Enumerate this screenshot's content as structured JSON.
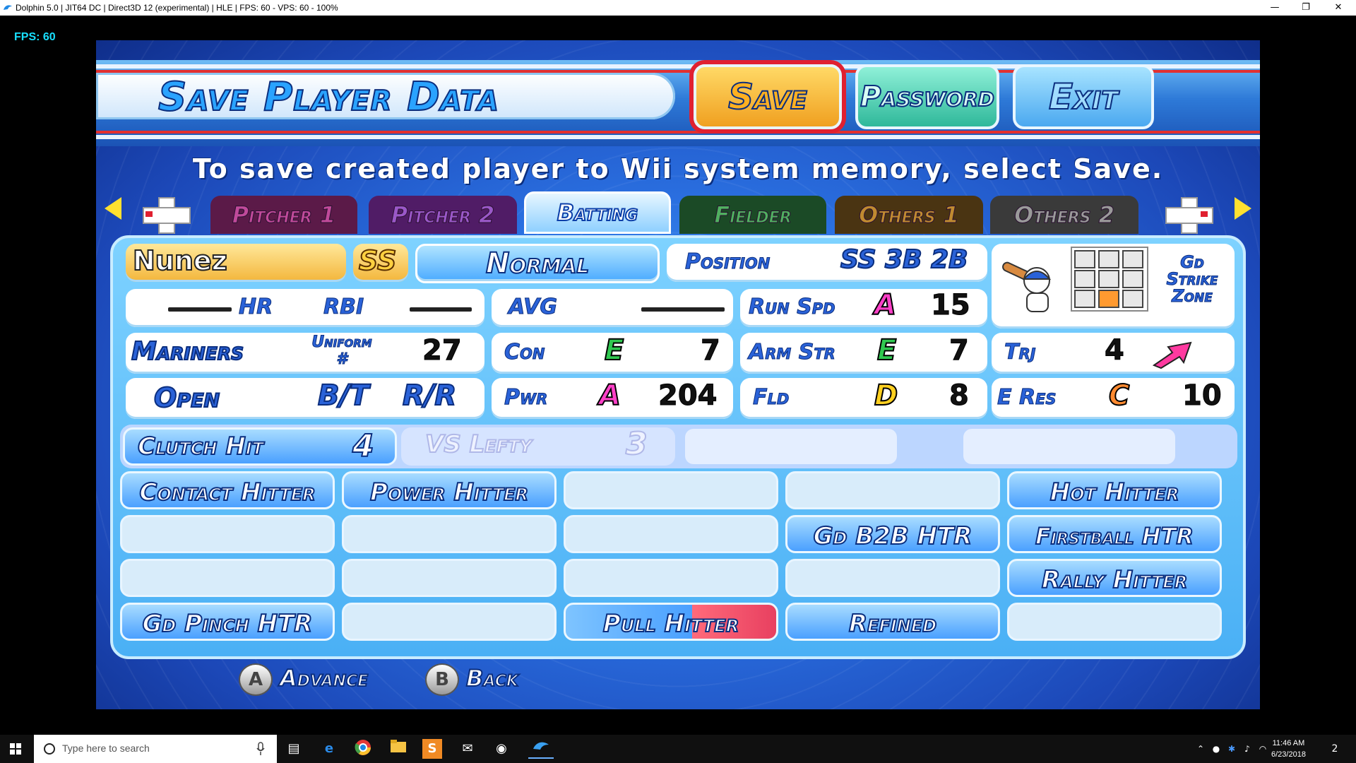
{
  "window": {
    "title": "Dolphin 5.0 | JIT64 DC | Direct3D 12 (experimental) | HLE | FPS: 60 - VPS: 60 - 100%",
    "minimize": "—",
    "maximize": "❐",
    "close": "✕"
  },
  "overlay": {
    "fps": "FPS: 60"
  },
  "header": {
    "title": "Save Player Data",
    "save": "Save",
    "password": "Password",
    "exit": "Exit"
  },
  "instruction": "To save created player to Wii system memory, select Save.",
  "tabs": [
    "Pitcher 1",
    "Pitcher 2",
    "Batting",
    "Fielder",
    "Others 1",
    "Others 2"
  ],
  "active_tab": "Batting",
  "player": {
    "name": "Nunez",
    "pos_badge": "SS",
    "mode": "Normal",
    "position_label": "Position",
    "positions": "SS 3B 2B",
    "hr_label": "HR",
    "rbi_label": "RBI",
    "avg_label": "AVG",
    "team": "Mariners",
    "uniform_label": "Uniform #",
    "uniform_no": "27",
    "bats_status": "Open",
    "bt_label": "B/T",
    "bt_value": "R/R",
    "strike_zone": "Gd Strike Zone"
  },
  "stats": {
    "run_spd": {
      "label": "Run Spd",
      "grade": "A",
      "value": "15"
    },
    "con": {
      "label": "Con",
      "grade": "E",
      "value": "7"
    },
    "arm_str": {
      "label": "Arm Str",
      "grade": "E",
      "value": "7"
    },
    "trj": {
      "label": "Trj",
      "value": "4"
    },
    "pwr": {
      "label": "Pwr",
      "grade": "A",
      "value": "204"
    },
    "fld": {
      "label": "Fld",
      "grade": "D",
      "value": "8"
    },
    "e_res": {
      "label": "E Res",
      "grade": "C",
      "value": "10"
    }
  },
  "special_row": {
    "clutch_label": "Clutch Hit",
    "clutch_val": "4",
    "lefty_label": "VS Lefty",
    "lefty_val": "3"
  },
  "abilities": [
    [
      "Contact Hitter",
      "Power Hitter",
      "",
      "",
      "Hot Hitter"
    ],
    [
      "",
      "",
      "",
      "Gd B2B HTR",
      "Firstball HTR"
    ],
    [
      "",
      "",
      "",
      "",
      "Rally Hitter"
    ],
    [
      "Gd Pinch HTR",
      "",
      "Pull Hitter",
      "Refined",
      ""
    ]
  ],
  "footer": {
    "a_btn": "A",
    "advance": "Advance",
    "b_btn": "B",
    "back": "Back"
  },
  "taskbar": {
    "search_placeholder": "Type here to search",
    "time": "11:46 AM",
    "date": "6/23/2018",
    "notif_count": "2"
  },
  "colors": {
    "grade_A": "#ff40c8",
    "grade_E": "#30c850",
    "grade_D": "#ffd020",
    "grade_C": "#ff8a30"
  }
}
